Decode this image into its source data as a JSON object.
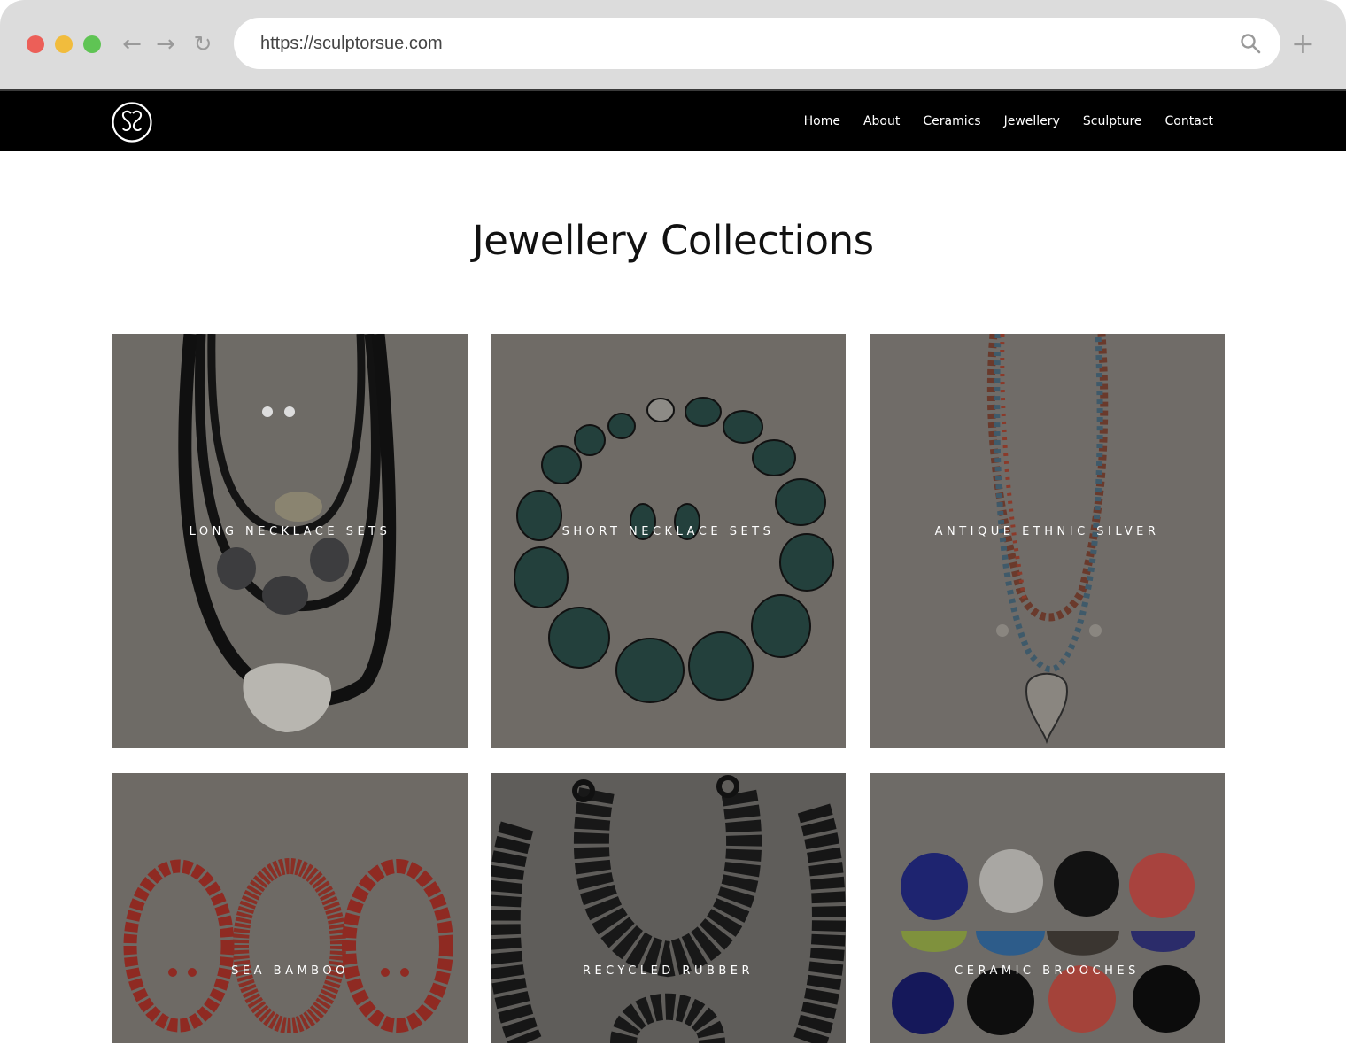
{
  "browser": {
    "url": "https://sculptorsue.com"
  },
  "header": {
    "logo": "SS monogram",
    "nav": [
      "Home",
      "About",
      "Ceramics",
      "Jewellery",
      "Sculpture",
      "Contact"
    ]
  },
  "page": {
    "title": "Jewellery Collections"
  },
  "collections": [
    {
      "label": "LONG NECKLACE SETS"
    },
    {
      "label": "SHORT NECKLACE SETS"
    },
    {
      "label": "ANTIQUE ETHNIC SILVER"
    },
    {
      "label": "SEA BAMBOO"
    },
    {
      "label": "RECYCLED RUBBER"
    },
    {
      "label": "CERAMIC BROOCHES"
    }
  ],
  "icons": {
    "back": "arrow-left-icon",
    "forward": "arrow-right-icon",
    "reload": "reload-icon",
    "search": "search-icon",
    "new_tab": "plus-icon"
  }
}
